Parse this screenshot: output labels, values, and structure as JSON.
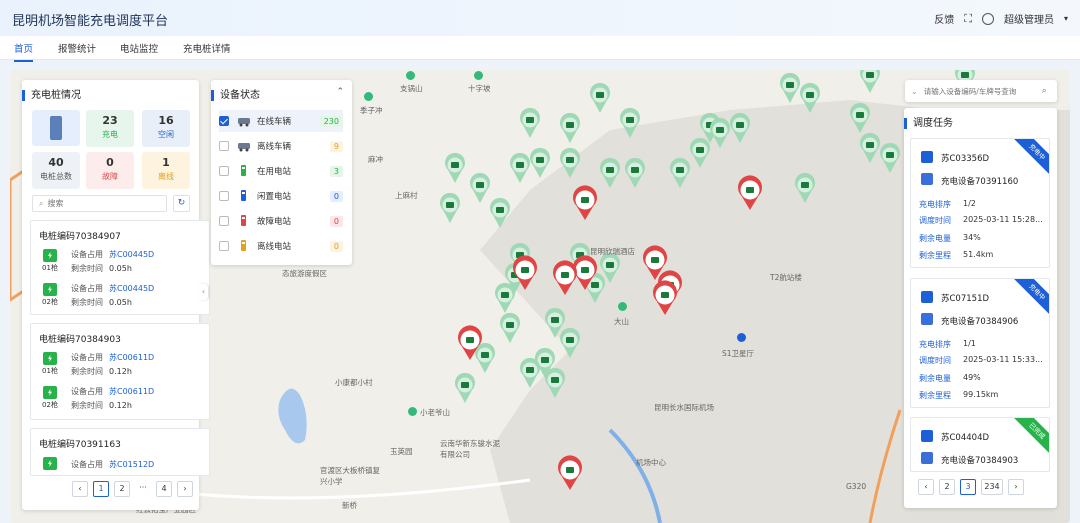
{
  "app": {
    "title": "昆明机场智能充电调度平台",
    "feedback": "反馈",
    "user": "超级管理员"
  },
  "nav": {
    "tabs": [
      "首页",
      "报警统计",
      "电站监控",
      "充电桩详情"
    ]
  },
  "pileSummary": {
    "title": "充电桩情况",
    "total": {
      "value": "40",
      "label": "电桩总数"
    },
    "charging": {
      "value": "23",
      "label": "充电"
    },
    "idle": {
      "value": "16",
      "label": "空闲"
    },
    "fault": {
      "value": "0",
      "label": "故障"
    },
    "offline": {
      "value": "1",
      "label": "离线"
    },
    "searchPlaceholder": "搜索",
    "piles": [
      {
        "code": "电桩编码70384907",
        "guns": [
          {
            "gun": "01枪",
            "occupy": "苏C00445D",
            "remain": "0.05h"
          },
          {
            "gun": "02枪",
            "occupy": "苏C00445D",
            "remain": "0.05h"
          }
        ]
      },
      {
        "code": "电桩编码70384903",
        "guns": [
          {
            "gun": "01枪",
            "occupy": "苏C00611D",
            "remain": "0.12h"
          },
          {
            "gun": "02枪",
            "occupy": "苏C00611D",
            "remain": "0.12h"
          }
        ]
      },
      {
        "code": "电桩编码70391163",
        "guns": [
          {
            "gun": "01枪",
            "occupy": "苏C01512D",
            "remain": ""
          }
        ]
      }
    ],
    "labels": {
      "occupy": "设备占用",
      "remain": "剩余时间"
    },
    "pager": {
      "pages": [
        "1",
        "2",
        "···",
        "4"
      ],
      "current": "1"
    }
  },
  "deviceStatus": {
    "title": "设备状态",
    "items": [
      {
        "label": "在线车辆",
        "count": "230",
        "checked": true,
        "color": "#27b24a",
        "bg": "#e3f6e8"
      },
      {
        "label": "离线车辆",
        "count": "9",
        "checked": false,
        "color": "#e3a11f",
        "bg": "#fdf3df"
      },
      {
        "label": "在用电站",
        "count": "3",
        "checked": false,
        "color": "#27b24a",
        "bg": "#e3f6e8"
      },
      {
        "label": "闲置电站",
        "count": "0",
        "checked": false,
        "color": "#1c5fd6",
        "bg": "#e4eefc"
      },
      {
        "label": "故障电站",
        "count": "0",
        "checked": false,
        "color": "#e04545",
        "bg": "#fde6e6"
      },
      {
        "label": "离线电站",
        "count": "0",
        "checked": false,
        "color": "#e3a11f",
        "bg": "#fdf3df"
      }
    ]
  },
  "dispatch": {
    "title": "调度任务",
    "searchPlaceholder": "请输入设备编码/车牌号查询",
    "labels": {
      "rank": "充电排序",
      "time": "调度时间",
      "power": "剩余电量",
      "mileage": "剩余里程"
    },
    "tasks": [
      {
        "plate": "苏C03356D",
        "device": "充电设备70391160",
        "status": "充电中",
        "statusColor": "#1c5fd6",
        "rank": "1/2",
        "time": "2025-03-11 15:28...",
        "power": "34%",
        "mileage": "51.4km"
      },
      {
        "plate": "苏C07151D",
        "device": "充电设备70384906",
        "status": "充电中",
        "statusColor": "#1c5fd6",
        "rank": "1/1",
        "time": "2025-03-11 15:33...",
        "power": "49%",
        "mileage": "99.15km"
      },
      {
        "plate": "苏C04404D",
        "device": "充电设备70384903",
        "status": "已完成",
        "statusColor": "#27b24a",
        "rank": "",
        "time": "",
        "power": "",
        "mileage": ""
      }
    ],
    "pager": {
      "pages": [
        "2",
        "3",
        "234"
      ],
      "current": "3"
    }
  },
  "mapLabels": [
    "季子冲",
    "支锅山",
    "十字坡",
    "麻冲",
    "上麻村",
    "昆明欣瑞酒店",
    "态旅游度假区",
    "T2航站楼",
    "大山",
    "S1卫星厅",
    "小康都小村",
    "小老爷山",
    "昆明长水国际机场",
    "云南华新东骏水泥有限公司",
    "官渡区大板桥镇复兴小学",
    "玉英园",
    "机场中心",
    "红云拓宝产业园区",
    "G320",
    "新桥"
  ]
}
